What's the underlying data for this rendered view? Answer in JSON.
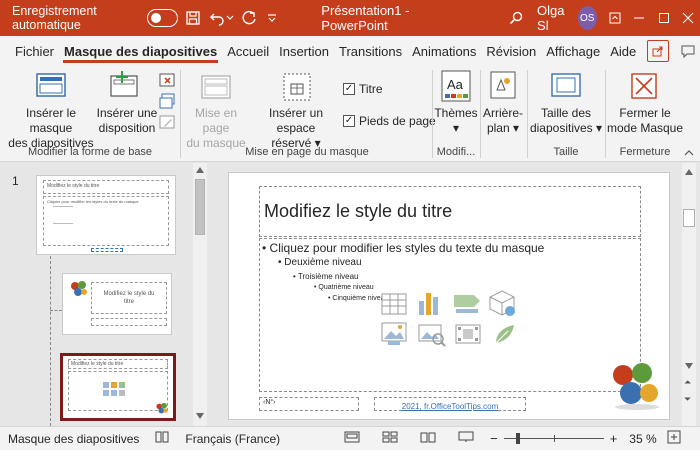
{
  "titlebar": {
    "autosave_label": "Enregistrement automatique",
    "doc_title": "Présentation1  -  PowerPoint",
    "user_name": "Olga Sl",
    "user_initials": "OS"
  },
  "tabs": [
    "Fichier",
    "Masque des diapositives",
    "Accueil",
    "Insertion",
    "Transitions",
    "Animations",
    "Révision",
    "Affichage",
    "Aide"
  ],
  "ribbon": {
    "insert_master": [
      "Insérer le masque",
      "des diapositives"
    ],
    "insert_layout": [
      "Insérer une",
      "disposition"
    ],
    "master_layout": [
      "Mise en page",
      "du masque"
    ],
    "insert_placeholder": [
      "Insérer un espace",
      "réservé ▾"
    ],
    "check_title": "Titre",
    "check_footers": "Pieds de page",
    "themes": [
      "Thèmes",
      "▾"
    ],
    "background": [
      "Arrière-",
      "plan ▾"
    ],
    "slide_size": [
      "Taille des",
      "diapositives ▾"
    ],
    "close_master": [
      "Fermer le",
      "mode Masque"
    ],
    "groups": [
      "Modifier la forme de base",
      "Mise en page du masque",
      "Modifi...",
      "Taille",
      "Fermeture"
    ]
  },
  "thumbnails": {
    "slide_number": "1",
    "master_title": "Modifiez le style du titre",
    "master_body": "Cliquez pour modifier les styles du texte du masque",
    "layout1_title": "Modifiez le style du titre",
    "layout2_title": "Modifiez le style du titre"
  },
  "slide": {
    "title": "Modifiez le style du titre",
    "levels": [
      "• Cliquez pour modifier les styles du texte du masque",
      "• Deuxième niveau",
      "• Troisième niveau",
      "• Quatrième niveau",
      "• Cinquième niveau"
    ],
    "footer_num": "‹N°›",
    "footer_text": "2021, fr.OfficeToolTips.com"
  },
  "statusbar": {
    "view_name": "Masque des diapositives",
    "language": "Français (France)",
    "zoom_minus": "−",
    "zoom_plus": "+",
    "zoom": "35 %",
    "zoom_level": 0.35
  },
  "colors": {
    "accent": "#c43e1c",
    "thumb_selected_border": "#7a1a1a"
  }
}
